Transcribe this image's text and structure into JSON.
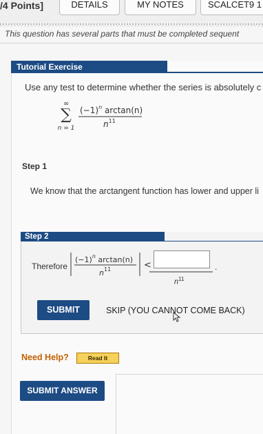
{
  "header": {
    "points_label": "/4 Points]",
    "details_label": "DETAILS",
    "my_notes_label": "MY NOTES",
    "course_label": "SCALCET9 1"
  },
  "question": {
    "intro": "This question has several parts that must be completed sequent"
  },
  "tutorial": {
    "header": "Tutorial Exercise",
    "instruction": "Use any test to determine whether the series is absolutely c",
    "series": {
      "sum_upper": "∞",
      "sum_lower": "n = 1",
      "numerator": "(−1)",
      "numerator_exp": "n",
      "numerator_fn": " arctan(n)",
      "denominator_base": "n",
      "denominator_exp": "11"
    }
  },
  "step1": {
    "label": "Step 1",
    "text": "We know that the arctangent function has lower and upper li"
  },
  "step2": {
    "label": "Step 2",
    "therefore": "Therefore",
    "frac_num": "(−1)",
    "frac_num_exp": "n",
    "frac_num_fn": " arctan(n)",
    "frac_den": "n",
    "frac_den_exp": "11",
    "less_than": "<",
    "answer_value": "",
    "answer_den": "n",
    "answer_den_exp": "11",
    "answer_period": "."
  },
  "actions": {
    "submit_label": "SUBMIT",
    "skip_label": "SKIP (YOU CANNOT COME BACK)"
  },
  "help": {
    "label": "Need Help?",
    "read_it_label": "Read It"
  },
  "footer": {
    "submit_answer_label": "SUBMIT ANSWER"
  },
  "colors": {
    "header_blue": "#1d4b84",
    "help_orange": "#c45f00",
    "read_it_yellow": "#f6d15b"
  }
}
